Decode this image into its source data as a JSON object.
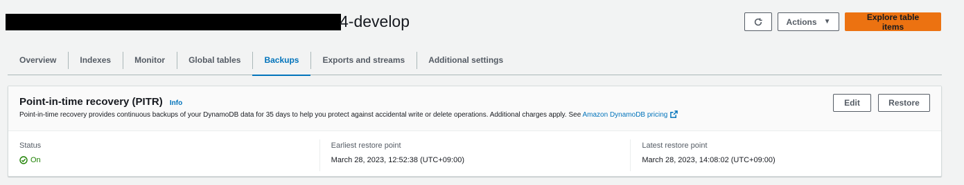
{
  "header": {
    "title_visible": "4-develop",
    "actions_label": "Actions",
    "primary_label": "Explore table items"
  },
  "tabs": [
    {
      "label": "Overview"
    },
    {
      "label": "Indexes"
    },
    {
      "label": "Monitor"
    },
    {
      "label": "Global tables"
    },
    {
      "label": "Backups",
      "active": true
    },
    {
      "label": "Exports and streams"
    },
    {
      "label": "Additional settings"
    }
  ],
  "pitr": {
    "title": "Point-in-time recovery (PITR)",
    "info_label": "Info",
    "description": "Point-in-time recovery provides continuous backups of your DynamoDB data for 35 days to help you protect against accidental write or delete operations. Additional charges apply. See ",
    "pricing_link": "Amazon DynamoDB pricing",
    "edit_label": "Edit",
    "restore_label": "Restore",
    "status_label": "Status",
    "status_value": "On",
    "earliest_label": "Earliest restore point",
    "earliest_value": "March 28, 2023, 12:52:38 (UTC+09:00)",
    "latest_label": "Latest restore point",
    "latest_value": "March 28, 2023, 14:08:02 (UTC+09:00)"
  },
  "colors": {
    "accent": "#0073bb",
    "primary_button": "#ec7211",
    "success": "#1d8102",
    "background": "#f2f3f3"
  },
  "icons": [
    "refresh-icon",
    "caret-down-icon",
    "external-link-icon",
    "status-ok-icon"
  ]
}
